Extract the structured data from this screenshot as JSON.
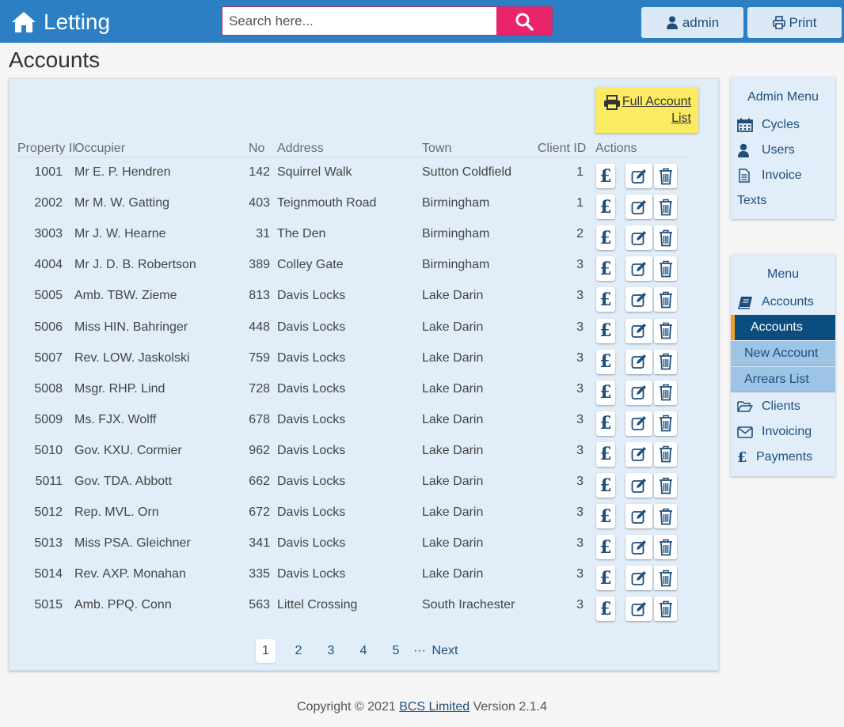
{
  "header": {
    "brand": "Letting",
    "search_placeholder": "Search here...",
    "admin_label": "admin",
    "print_label": "Print"
  },
  "page_title": "Accounts",
  "full_list": {
    "line1": "Full Account",
    "line2": "List"
  },
  "table": {
    "headers": {
      "property_id": "Property ID",
      "occupier": "Occupier",
      "no": "No",
      "address": "Address",
      "town": "Town",
      "client_id": "Client ID",
      "actions": "Actions"
    },
    "pay_glyph": "£",
    "rows": [
      {
        "id": "1001",
        "occupier": "Mr E. P. Hendren",
        "no": "142",
        "address": "Squirrel Walk",
        "town": "Sutton Coldfield",
        "client": "1"
      },
      {
        "id": "2002",
        "occupier": "Mr M. W. Gatting",
        "no": "403",
        "address": "Teignmouth Road",
        "town": "Birmingham",
        "client": "1"
      },
      {
        "id": "3003",
        "occupier": "Mr J. W. Hearne",
        "no": "31",
        "address": "The Den",
        "town": "Birmingham",
        "client": "2"
      },
      {
        "id": "4004",
        "occupier": "Mr J. D. B. Robertson",
        "no": "389",
        "address": "Colley Gate",
        "town": "Birmingham",
        "client": "3"
      },
      {
        "id": "5005",
        "occupier": "Amb. TBW. Zieme",
        "no": "813",
        "address": "Davis Locks",
        "town": "Lake Darin",
        "client": "3"
      },
      {
        "id": "5006",
        "occupier": "Miss HIN. Bahringer",
        "no": "448",
        "address": "Davis Locks",
        "town": "Lake Darin",
        "client": "3"
      },
      {
        "id": "5007",
        "occupier": "Rev. LOW. Jaskolski",
        "no": "759",
        "address": "Davis Locks",
        "town": "Lake Darin",
        "client": "3"
      },
      {
        "id": "5008",
        "occupier": "Msgr. RHP. Lind",
        "no": "728",
        "address": "Davis Locks",
        "town": "Lake Darin",
        "client": "3"
      },
      {
        "id": "5009",
        "occupier": "Ms. FJX. Wolff",
        "no": "678",
        "address": "Davis Locks",
        "town": "Lake Darin",
        "client": "3"
      },
      {
        "id": "5010",
        "occupier": "Gov. KXU. Cormier",
        "no": "962",
        "address": "Davis Locks",
        "town": "Lake Darin",
        "client": "3"
      },
      {
        "id": "5011",
        "occupier": "Gov. TDA. Abbott",
        "no": "662",
        "address": "Davis Locks",
        "town": "Lake Darin",
        "client": "3"
      },
      {
        "id": "5012",
        "occupier": "Rep. MVL. Orn",
        "no": "672",
        "address": "Davis Locks",
        "town": "Lake Darin",
        "client": "3"
      },
      {
        "id": "5013",
        "occupier": "Miss PSA. Gleichner",
        "no": "341",
        "address": "Davis Locks",
        "town": "Lake Darin",
        "client": "3"
      },
      {
        "id": "5014",
        "occupier": "Rev. AXP. Monahan",
        "no": "335",
        "address": "Davis Locks",
        "town": "Lake Darin",
        "client": "3"
      },
      {
        "id": "5015",
        "occupier": "Amb. PPQ. Conn",
        "no": "563",
        "address": "Littel Crossing",
        "town": "South Irachester",
        "client": "3"
      }
    ]
  },
  "pagination": {
    "pages": [
      "1",
      "2",
      "3",
      "4",
      "5"
    ],
    "ellipsis": "···",
    "next": "Next",
    "current": "1"
  },
  "admin_menu": {
    "title": "Admin Menu",
    "items": [
      "Cycles",
      "Users",
      "Invoice",
      "Texts"
    ]
  },
  "menu": {
    "title": "Menu",
    "accounts": "Accounts",
    "accounts_active": "Accounts",
    "new_account": "New Account",
    "arrears_list": "Arrears List",
    "clients": "Clients",
    "invoicing": "Invoicing",
    "payments": "Payments",
    "payments_glyph": "£"
  },
  "footer": {
    "prefix": "Copyright © 2021",
    "company": "BCS Limited",
    "version": "Version 2.1.4"
  },
  "colors": {
    "header": "#2d7fc4",
    "search_button": "#e8246b",
    "panel": "#e1eefa",
    "full_list": "#fbeb62",
    "menu_active": "#0c4d80",
    "menu_accent": "#f0a025",
    "text_blue": "#1f4e7d"
  }
}
